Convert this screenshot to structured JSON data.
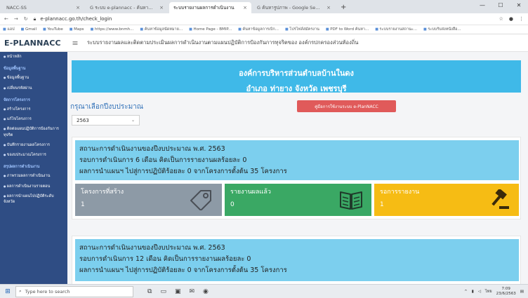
{
  "browser": {
    "tabs": [
      {
        "label": "NACC-SS"
      },
      {
        "label": "G ระบบ e-plannacc - ค้นหาด้วย Google"
      },
      {
        "label": "ระบบรายงานผลการดำเนินงาน"
      },
      {
        "label": "G ค้นหารูปภาพ - Google Search"
      }
    ],
    "new_tab": "+",
    "url": "e-plannacc.go.th/check_login",
    "bookmarks": [
      "แอป",
      "Gmail",
      "YouTube",
      "Maps",
      "https://www.bnmh...",
      "ค้นหาข้อมูลนัดหมาย...",
      "Home Page - BMIP...",
      "ค้นหาข้อมูลการเบิก...",
      "โปรไฟล์สมัครงาน",
      "PDF to Word ค้นหา...",
      "ระบบรายงานสถานะ...",
      "ระบบรับส่งหนังสือ..."
    ]
  },
  "app": {
    "logo": "E-PLANNACC",
    "menu_icon": "≡",
    "title": "ระบบรายงานผลและติดตามประเมินผลการดำเนินงานตามแผนปฏิบัติการป้องกันการทุจริตของ องค์กรปกครองส่วนท้องถิ่น"
  },
  "sidebar": {
    "items": [
      {
        "type": "item",
        "label": "หน้าหลัก"
      },
      {
        "type": "head",
        "label": "ข้อมูลพื้นฐาน"
      },
      {
        "type": "item",
        "label": "ข้อมูลพื้นฐาน"
      },
      {
        "type": "item",
        "label": "เปลี่ยนรหัสผ่าน"
      },
      {
        "type": "head",
        "label": "จัดการโครงการ"
      },
      {
        "type": "item",
        "label": "สร้างโครงการ"
      },
      {
        "type": "item",
        "label": "แก้ไขโครงการ"
      },
      {
        "type": "item",
        "label": "ติดต่อแผนปฏิบัติการป้องกันการทุจริต"
      },
      {
        "type": "item",
        "label": "บันทึกรายงานผลโครงการ"
      },
      {
        "type": "item",
        "label": "ของบประมาณโครงการ"
      },
      {
        "type": "head",
        "label": "สรุปผลการดำเนินงาน"
      },
      {
        "type": "item",
        "label": "ภาพรวมผลการดำเนินงาน"
      },
      {
        "type": "item",
        "label": "ผลการดำเนินงานรายตอน"
      },
      {
        "type": "item",
        "label": "ผลการนำแผนไปปฏิบัติระดับจังหวัด"
      }
    ]
  },
  "main": {
    "org_name": "องค์การบริหารส่วนตำบลบ้านในดง",
    "org_location": "อำเภอ ท่ายาง จังหวัด เพชรบุรี",
    "year_prompt": "กรุณาเลือกปีงบประมาณ",
    "guide_button": "คู่มือการใช้งานระบบ e-PlanNACC",
    "selected_year": "2563",
    "select_chevron": "⌄",
    "cards": [
      {
        "line1": "สถานะการดำเนินงานของปีงบประมาณ พ.ศ. 2563",
        "line2": "รอบการดำเนินการ 6 เดือน คิดเป็นการรายงานผลร้อยละ 0",
        "line3": "ผลการนำแผนฯ ไปสู่การปฏิบัติร้อยละ 0 จากโครงการตั้งต้น 35 โครงการ",
        "tiles": [
          {
            "label": "โครงการที่สร้าง",
            "value": "1"
          },
          {
            "label": "รายงานผลแล้ว",
            "value": "0"
          },
          {
            "label": "รอการรายงาน",
            "value": "1"
          }
        ]
      },
      {
        "line1": "สถานะการดำเนินงานของปีงบประมาณ พ.ศ. 2563",
        "line2": "รอบการดำเนินการ 12 เดือน คิดเป็นการรายงานผลร้อยละ 0",
        "line3": "ผลการนำแผนฯ ไปสู่การปฏิบัติร้อยละ 0 จากโครงการตั้งต้น 35 โครงการ"
      }
    ],
    "colors": {
      "banner": "#3fb9e8",
      "status": "#7ccfee",
      "tile_created": "#8d9aa6",
      "tile_reported": "#3aa864",
      "tile_waiting": "#f6bc14",
      "guide_button": "#e05a5a",
      "sidebar": "#2f4d84"
    }
  },
  "taskbar": {
    "search_placeholder": "Type here to search",
    "language": "ไทย",
    "time": "7:09",
    "date": "23/6/2563"
  }
}
